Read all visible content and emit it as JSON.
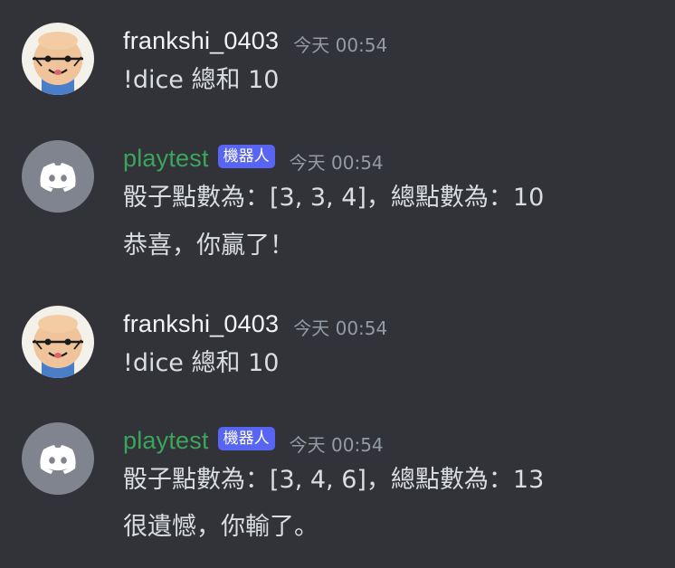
{
  "colors": {
    "background": "#313338",
    "text": "#dbdee1",
    "human_username": "#f2f3f5",
    "bot_username": "#3ba55c",
    "bot_tag_bg": "#5865f2",
    "timestamp": "#949ba4",
    "discord_avatar_bg": "#80848e"
  },
  "messages": [
    {
      "author": "frankshi_0403",
      "avatar_icon": "cartoon-face-avatar-icon",
      "timestamp": "今天 00:54",
      "lines": [
        "!dice 總和 10"
      ]
    },
    {
      "author": "playtest",
      "bot_tag": "機器人",
      "avatar_icon": "discord-logo-icon",
      "timestamp": "今天 00:54",
      "lines": [
        "骰子點數為：[3, 3, 4]，總點數為：10",
        "恭喜，你贏了！"
      ]
    },
    {
      "author": "frankshi_0403",
      "avatar_icon": "cartoon-face-avatar-icon",
      "timestamp": "今天 00:54",
      "lines": [
        "!dice 總和 10"
      ]
    },
    {
      "author": "playtest",
      "bot_tag": "機器人",
      "avatar_icon": "discord-logo-icon",
      "timestamp": "今天 00:54",
      "lines": [
        "骰子點數為：[3, 4, 6]，總點數為：13",
        "很遺憾，你輸了。"
      ]
    }
  ]
}
